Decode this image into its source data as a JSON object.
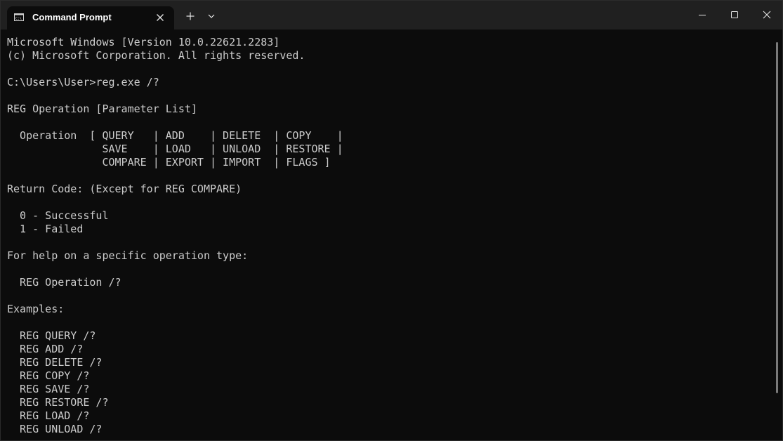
{
  "window": {
    "tab_title": "Command Prompt"
  },
  "icons": {
    "tab": "cmd-app-icon",
    "close_tab": "close-icon",
    "new_tab": "plus-icon",
    "dropdown": "chevron-down-icon",
    "minimize": "minimize-icon",
    "maximize": "maximize-icon",
    "close_window": "close-icon"
  },
  "colors": {
    "background": "#0c0c0c",
    "titlebar": "#202020",
    "text": "#cccccc"
  },
  "terminal": {
    "lines": [
      "Microsoft Windows [Version 10.0.22621.2283]",
      "(c) Microsoft Corporation. All rights reserved.",
      "",
      "C:\\Users\\User>reg.exe /?",
      "",
      "REG Operation [Parameter List]",
      "",
      "  Operation  [ QUERY   | ADD    | DELETE  | COPY    |",
      "               SAVE    | LOAD   | UNLOAD  | RESTORE |",
      "               COMPARE | EXPORT | IMPORT  | FLAGS ]",
      "",
      "Return Code: (Except for REG COMPARE)",
      "",
      "  0 - Successful",
      "  1 - Failed",
      "",
      "For help on a specific operation type:",
      "",
      "  REG Operation /?",
      "",
      "Examples:",
      "",
      "  REG QUERY /?",
      "  REG ADD /?",
      "  REG DELETE /?",
      "  REG COPY /?",
      "  REG SAVE /?",
      "  REG RESTORE /?",
      "  REG LOAD /?",
      "  REG UNLOAD /?"
    ]
  }
}
